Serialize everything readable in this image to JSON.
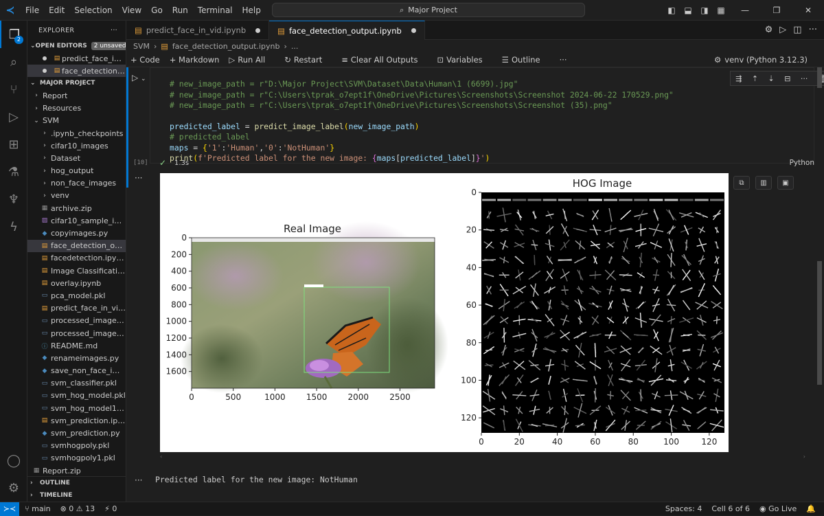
{
  "menu": [
    "File",
    "Edit",
    "Selection",
    "View",
    "Go",
    "Run",
    "Terminal",
    "Help"
  ],
  "search": "Major Project",
  "explorer": {
    "title": "EXPLORER",
    "open_editors": "OPEN EDITORS",
    "unsaved": "2 unsaved",
    "open_files": [
      "predict_face_in_...",
      "face_detection_..."
    ],
    "project": "MAJOR PROJECT",
    "items": [
      {
        "label": "Report",
        "kind": "folder",
        "indent": 1
      },
      {
        "label": "Resources",
        "kind": "folder",
        "indent": 1
      },
      {
        "label": "SVM",
        "kind": "folder-open",
        "indent": 1
      },
      {
        "label": ".ipynb_checkpoints",
        "kind": "folder",
        "indent": 2
      },
      {
        "label": "cifar10_images",
        "kind": "folder",
        "indent": 2
      },
      {
        "label": "Dataset",
        "kind": "folder",
        "indent": 2
      },
      {
        "label": "hog_output",
        "kind": "folder",
        "indent": 2
      },
      {
        "label": "non_face_images",
        "kind": "folder",
        "indent": 2
      },
      {
        "label": "venv",
        "kind": "folder",
        "indent": 2
      },
      {
        "label": "archive.zip",
        "kind": "zip",
        "indent": 2
      },
      {
        "label": "cifar10_sample_ima...",
        "kind": "image",
        "indent": 2
      },
      {
        "label": "copyimages.py",
        "kind": "py",
        "indent": 2
      },
      {
        "label": "face_detection_outp...",
        "kind": "nb",
        "indent": 2,
        "selected": true
      },
      {
        "label": "facedetection.ipynb",
        "kind": "nb",
        "indent": 2
      },
      {
        "label": "Image Classification....",
        "kind": "nb",
        "indent": 2
      },
      {
        "label": "overlay.ipynb",
        "kind": "nb",
        "indent": 2
      },
      {
        "label": "pca_model.pkl",
        "kind": "file",
        "indent": 2
      },
      {
        "label": "predict_face_in_vid.i...",
        "kind": "nb",
        "indent": 2
      },
      {
        "label": "processed_images.pkl",
        "kind": "file",
        "indent": 2
      },
      {
        "label": "processed_images1....",
        "kind": "file",
        "indent": 2
      },
      {
        "label": "README.md",
        "kind": "info",
        "indent": 2
      },
      {
        "label": "renameimages.py",
        "kind": "py",
        "indent": 2
      },
      {
        "label": "save_non_face_img.py",
        "kind": "py",
        "indent": 2
      },
      {
        "label": "svm_classifier.pkl",
        "kind": "file",
        "indent": 2
      },
      {
        "label": "svm_hog_model.pkl",
        "kind": "file",
        "indent": 2
      },
      {
        "label": "svm_hog_model1.pkl",
        "kind": "file",
        "indent": 2
      },
      {
        "label": "svm_prediction.ipynb",
        "kind": "nb",
        "indent": 2
      },
      {
        "label": "svm_prediction.py",
        "kind": "py",
        "indent": 2
      },
      {
        "label": "svmhogpoly.pkl",
        "kind": "file",
        "indent": 2
      },
      {
        "label": "svmhogpoly1.pkl",
        "kind": "file",
        "indent": 2
      },
      {
        "label": "Report.zip",
        "kind": "zip",
        "indent": 1
      }
    ],
    "outline": "OUTLINE",
    "timeline": "TIMELINE"
  },
  "tabs": [
    {
      "label": "predict_face_in_vid.ipynb",
      "active": false
    },
    {
      "label": "face_detection_output.ipynb",
      "active": true
    }
  ],
  "breadcrumb": [
    "SVM",
    "face_detection_output.ipynb",
    "..."
  ],
  "toolbar": {
    "code": "+ Code",
    "markdown": "+ Markdown",
    "run_all": "Run All",
    "restart": "Restart",
    "clear": "Clear All Outputs",
    "variables": "Variables",
    "outline": "Outline",
    "more": "···",
    "kernel": "venv (Python 3.12.3)"
  },
  "cell": {
    "comment1": "# new_image_path = r\"D:\\Major Project\\SVM\\Dataset\\Data\\Human\\1 (6699).jpg\"",
    "comment2": "# new_image_path = r\"C:\\Users\\tprak_o7ept1f\\OneDrive\\Pictures\\Screenshots\\Screenshot 2024-06-22 170529.png\"",
    "comment3": "# new_image_path = r\"C:\\Users\\tprak_o7ept1f\\OneDrive\\Pictures\\Screenshots\\Screenshot (35).png\"",
    "line_pred_var": "predicted_label",
    "line_pred_fn": "predict_image_label",
    "line_pred_arg": "new_image_path",
    "comment4": "# predicted_label",
    "maps_var": "maps",
    "maps_k1": "'1'",
    "maps_v1": "'Human'",
    "maps_k2": "'0'",
    "maps_v2": "'NotHuman'",
    "print_fn": "print",
    "print_str": "f'Predicted label for the new image: ",
    "print_expr_var": "maps",
    "print_expr_idx": "predicted_label",
    "print_end": "'",
    "exec_count": "[10]",
    "duration": "1.3s",
    "language": "Python"
  },
  "figure": {
    "real_title": "Real Image",
    "hog_title": "HOG Image",
    "real_xticks": [
      "0",
      "500",
      "1000",
      "1500",
      "2000",
      "2500"
    ],
    "real_yticks": [
      "0",
      "200",
      "400",
      "600",
      "800",
      "1000",
      "1200",
      "1400",
      "1600"
    ],
    "hog_xticks": [
      "0",
      "20",
      "40",
      "60",
      "80",
      "100",
      "120"
    ],
    "hog_yticks": [
      "0",
      "20",
      "40",
      "60",
      "80",
      "100",
      "120"
    ]
  },
  "output_text": "Predicted label for the new image: NotHuman",
  "statusbar": {
    "branch": "main",
    "problems": "⊗ 0 ⚠ 13",
    "ports": "⚡ 0",
    "spaces": "Spaces: 4",
    "cell": "Cell 6 of 6",
    "golive": "Go Live"
  }
}
